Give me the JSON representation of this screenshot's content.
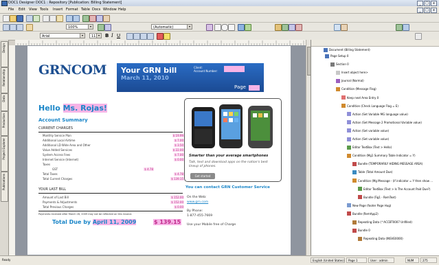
{
  "window": {
    "title": "DOC1 Designer DOC1 : Repository [Publication: Billing Statement]",
    "controls": [
      "_",
      "□",
      "x"
    ]
  },
  "menubar": {
    "items": [
      "File",
      "Edit",
      "View",
      "Tools",
      "Insert",
      "Format",
      "Table",
      "Docs",
      "Window",
      "Help"
    ]
  },
  "toolbar": {
    "zoom": "100%",
    "style": "(Automatic)",
    "font": "Arial",
    "font_size": "11",
    "bold": "B",
    "italic": "I",
    "underline": "U"
  },
  "left_tabs": [
    "Design",
    "Relationship",
    "Data",
    "Production",
    "Project Explorer",
    "Publications"
  ],
  "tree": {
    "root": "Document (Billing Statement)",
    "nodes": [
      {
        "label": "Page Setup 0",
        "icon": "page-setup-icon"
      },
      {
        "label": "Section 0",
        "icon": "section-icon"
      },
      {
        "label": "Insert object here>",
        "icon": "insert-icon"
      },
      {
        "label": "Journal (Normal)",
        "icon": "journal-icon"
      },
      {
        "label": "Condition (Message Flag)",
        "icon": "condition-icon"
      },
      {
        "label": "Keep next Area Entry 0",
        "icon": "keep-icon"
      },
      {
        "label": "Condition (Check Language Flag = E)",
        "icon": "condition-icon"
      },
      {
        "label": "Action (Set Variable MG language value)",
        "icon": "action-icon"
      },
      {
        "label": "Action (Set Message 2 Promotional Variable value)",
        "icon": "action-icon"
      },
      {
        "label": "Action (Set variable value)",
        "icon": "action-icon"
      },
      {
        "label": "Action (Set variable value)",
        "icon": "action-icon"
      },
      {
        "label": "Editor TextBox (Text > Hello)",
        "icon": "editor-icon"
      },
      {
        "label": "Condition (Mg1 Summary Table Indicator = Y)",
        "icon": "condition-icon"
      },
      {
        "label": "Bundle (TEMPORARILY HIDING MESSAGE AREA)",
        "icon": "bundle-icon"
      },
      {
        "label": "Table (Total Amount Due)",
        "icon": "table-icon"
      },
      {
        "label": "Condition (Mg Message - (if indicator = Y then show ...",
        "icon": "condition-icon"
      },
      {
        "label": "Editor TextBox (Text > Is The Account Paid Due?)",
        "icon": "editor-icon"
      },
      {
        "label": "Bundle (Fig1 - RemText)",
        "icon": "bundle-icon"
      },
      {
        "label": "New Page (footer Page Hug)",
        "icon": "newpage-icon"
      },
      {
        "label": "Bundle (RemApp2)",
        "icon": "bundle-icon"
      },
      {
        "label": "Repeating Data (^ACCBT0007 Unfilled)",
        "icon": "repeat-icon"
      },
      {
        "label": "Bundle 0",
        "icon": "bundle-icon"
      },
      {
        "label": "Repeating Data (INSVE0000)",
        "icon": "repeat-icon"
      }
    ]
  },
  "bill": {
    "logo": "GRNCOM",
    "banner_title": "Your GRN bill",
    "banner_date": "March 11, 2010",
    "client_label": "Client:",
    "account_label": "Account Number:",
    "page_label": "Page",
    "hello_prefix": "Hello ",
    "hello_name": "Ms. Rojas!",
    "account_summary": "Account Summary",
    "current_charges_title": "CURRENT CHARGES",
    "current_charges": [
      {
        "label": "Monthly Service Plan",
        "value": "$ 19.99"
      },
      {
        "label": "Additional Local Airtime",
        "value": "$ 7.00"
      },
      {
        "label": "Additional LD Wide Area and Other",
        "value": "$ 3.50"
      },
      {
        "label": "Value Added Services",
        "value": "$ 22.00"
      },
      {
        "label": "System Access Fees",
        "value": "$ 7.00"
      },
      {
        "label": "Internet Service (Internet)",
        "value": "$ 0.00"
      },
      {
        "label": "Taxes",
        "value": ""
      },
      {
        "label": "GST",
        "value2": "$ 4.78"
      },
      {
        "label": "Total Taxes",
        "value": "$ 4.78"
      },
      {
        "label": "Total Current Charges",
        "value": "$ 139.15"
      }
    ],
    "last_bill_title": "YOUR LAST BILL",
    "last_bill": [
      {
        "label": "Amount of Last Bill",
        "value": "$ 152.00"
      },
      {
        "label": "Payments & Adjustments",
        "value": "$ 152.00"
      },
      {
        "label": "Total Previous Charges",
        "value": "$ 0.00"
      }
    ],
    "payment_note": "Payments received after March 28, 2009 may not be reflected on this invoice.",
    "total_due_label": "Total Due by ",
    "total_due_date": "April 11, 2009",
    "total_due_amount": "$ 139.15",
    "ad_headline": "Smarter than your average smartphones",
    "ad_text": "Talk, text and download apps on the nation's best lineup of phones.",
    "ad_button": "Get started",
    "contact_title": "You can contact GRN Customer Service",
    "web_label": "On the Web:",
    "web_url": "www.grn.com",
    "phone_label": "By Phone:",
    "phone_number": "1-877-455-7669",
    "mobile_note": "Use your Mobile free of Charge"
  },
  "status": {
    "left": "Ready",
    "language": "English (United States)",
    "page": "Page 1",
    "user": "User : admin",
    "num": "NUM",
    "zoom": "275"
  }
}
